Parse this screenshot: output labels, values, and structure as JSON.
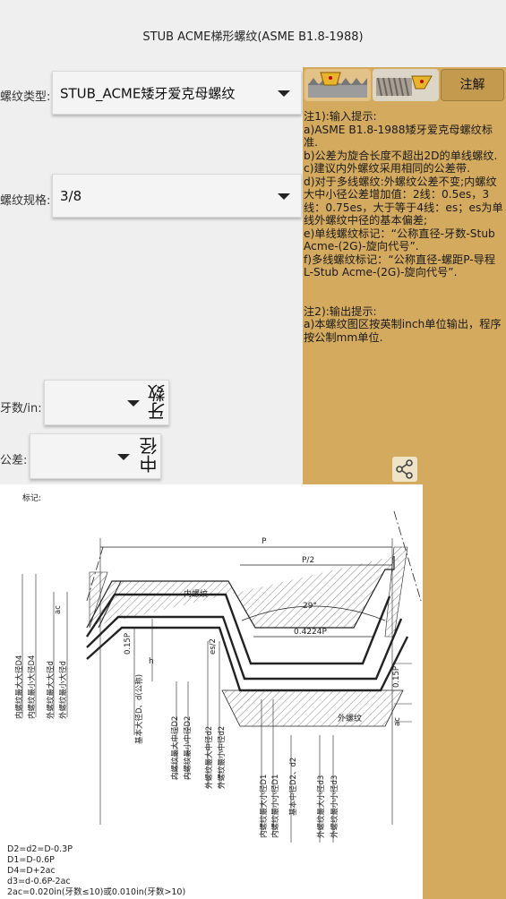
{
  "title": "STUB ACME梯形螺纹(ASME B1.8-1988)",
  "thread_type": {
    "label": "螺纹类型:",
    "value": "STUB_ACME矮牙爱克母螺纹"
  },
  "thread_spec": {
    "label": "螺纹规格:",
    "value": "3/8"
  },
  "tpi": {
    "label": "牙数/in:",
    "side_label": "牙数"
  },
  "tolerance": {
    "label": "公差:",
    "side_label": "中径"
  },
  "notes_button": "注解",
  "notes": [
    "注1):输入提示:",
    " a)ASME B1.8-1988矮牙爱克母螺纹标准.",
    " b)公差为旋合长度不超出2D的单线螺纹.",
    " c)建议内外螺纹采用相同的公差带.",
    " d)对于多线螺纹:外螺纹公差不变;内螺纹大中小径公差增加值：2线：0.5es，3线：0.75es，大于等于4线：es；es为单线外螺纹中径的基本偏差;",
    " e)单线螺纹标记：“公称直径-牙数-Stub Acme-(2G)-旋向代号”.",
    " f)多线螺纹标记：“公称直径-螺距P-导程L-Stub Acme-(2G)-旋向代号”.",
    "",
    "",
    " 注2):输出提示:",
    " a)本螺纹图区按英制inch单位输出，程序按公制mm单位."
  ],
  "drawing": {
    "mark_label": "标记:",
    "labels": {
      "P": "P",
      "P2": "P/2",
      "angle": "29°",
      "width": "0.4224P",
      "internal": "内螺纹",
      "external": "外螺纹",
      "h": "h",
      "es2": "es/2",
      "ac_left": "ac",
      "ac_right": "ac",
      "p015_left": "0.15P",
      "p015_right": "0.15P",
      "D4max": "内螺纹最大大径D4",
      "D4min": "内螺纹最小大径D4",
      "dmax": "外螺纹最大大径d",
      "dmin": "外螺纹最小大径d",
      "basic_major": "基本大径D、d(公称)",
      "D2max": "内螺纹最大中径D2",
      "D2min": "内螺纹最小中径D2",
      "d2max": "外螺纹最大中径d2",
      "d2min": "外螺纹最小中径d2",
      "D1max": "内螺纹最大小径D1",
      "D1min": "内螺纹最小小径D1",
      "basic_pitch": "基本中径D2、d2",
      "d3max": "外螺纹最大小径d3",
      "d3min": "外螺纹最小小径d3"
    },
    "formulas": [
      "D2=d2=D-0.3P",
      "D1=D-0.6P",
      "D4=D+2ac",
      "d3=d-0.6P-2ac",
      "2ac=0.020in(牙数≤10)或0.010in(牙数>10)"
    ]
  }
}
